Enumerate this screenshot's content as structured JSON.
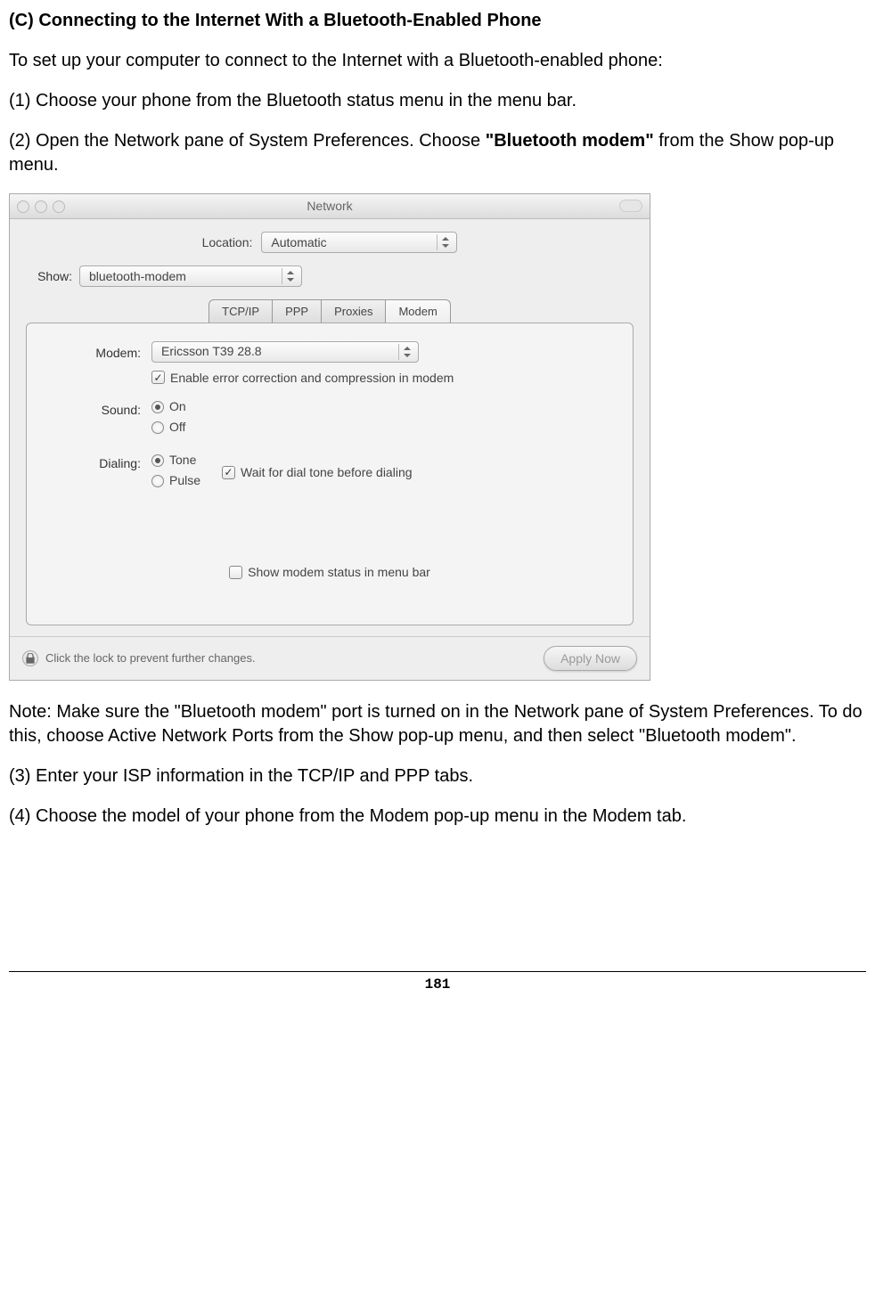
{
  "doc": {
    "heading": "(C) Connecting to the Internet With a Bluetooth-Enabled Phone",
    "intro": "To set up your computer to connect to the Internet with a Bluetooth-enabled phone:",
    "step1": "(1) Choose your phone from the Bluetooth status menu in the menu bar.",
    "step2_a": "(2) Open the Network pane of System Preferences. Choose ",
    "step2_bold": "\"Bluetooth modem\"",
    "step2_b": " from the Show pop-up menu.",
    "note": "Note: Make sure the \"Bluetooth modem\" port is turned on in the Network pane of System Preferences. To do this, choose Active Network Ports from the Show pop-up menu, and then select \"Bluetooth modem\".",
    "step3": "(3) Enter your ISP information in the TCP/IP and PPP tabs.",
    "step4": "(4) Choose the model of your phone from the Modem pop-up menu in the Modem tab.",
    "page_number": "181"
  },
  "window": {
    "title": "Network",
    "location_label": "Location:",
    "location_value": "Automatic",
    "show_label": "Show:",
    "show_value": "bluetooth-modem",
    "tabs": [
      "TCP/IP",
      "PPP",
      "Proxies",
      "Modem"
    ],
    "panel": {
      "modem_label": "Modem:",
      "modem_value": "Ericsson T39 28.8",
      "enable_error": "Enable error correction and compression in modem",
      "sound_label": "Sound:",
      "sound_on": "On",
      "sound_off": "Off",
      "dialing_label": "Dialing:",
      "dialing_tone": "Tone",
      "dialing_pulse": "Pulse",
      "wait_dial": "Wait for dial tone before dialing",
      "show_status": "Show modem status in menu bar"
    },
    "lock_text": "Click the lock to prevent further changes.",
    "apply": "Apply Now"
  }
}
